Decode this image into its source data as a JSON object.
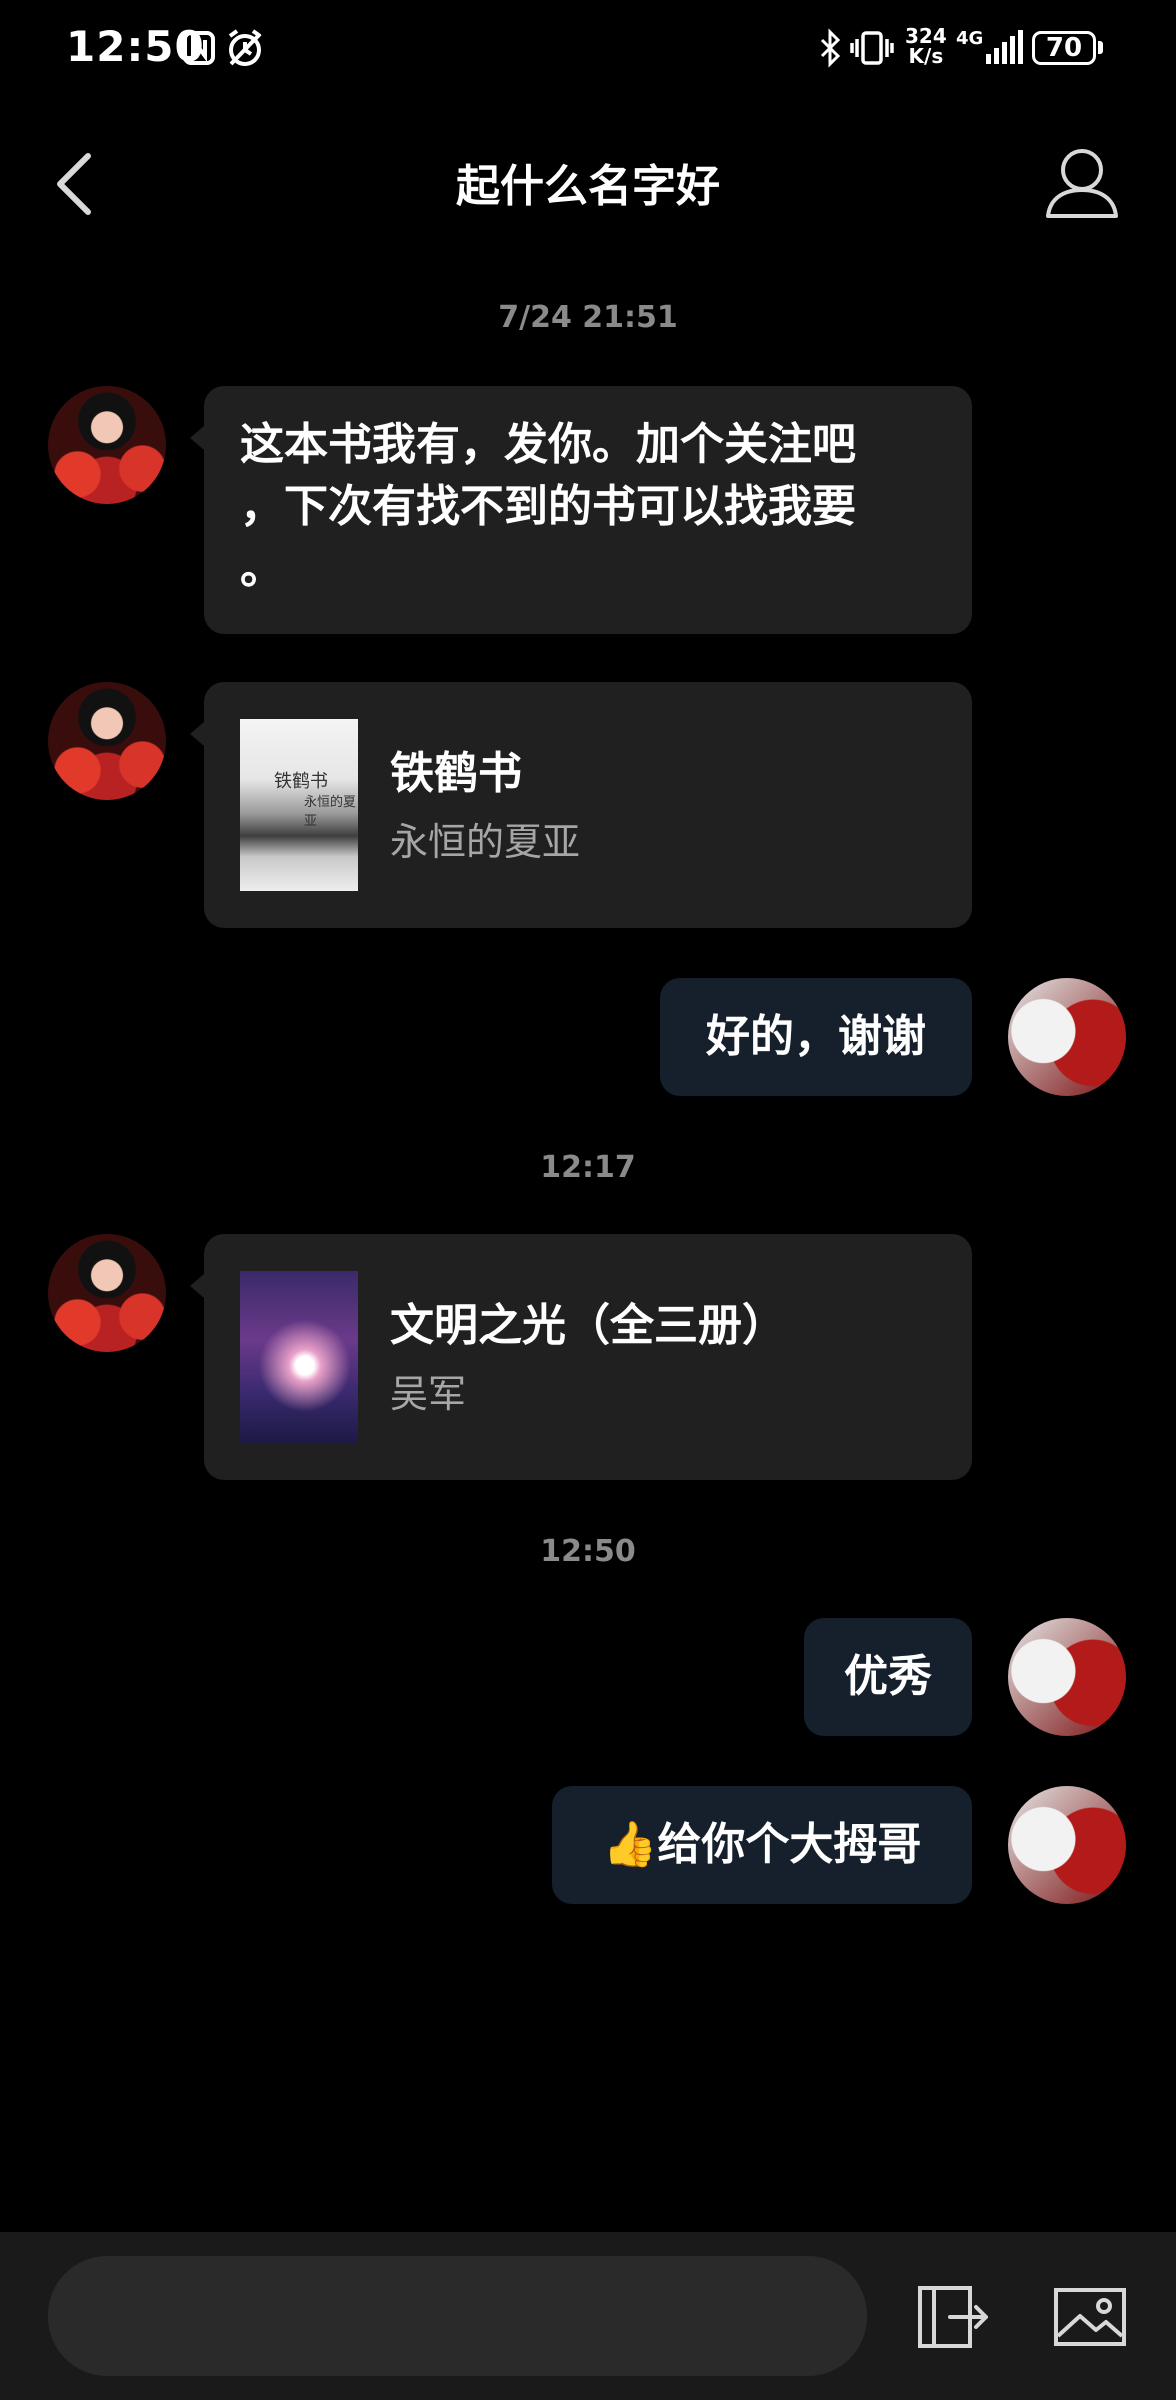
{
  "status_bar": {
    "time": "12:50",
    "speed_value": "324",
    "speed_unit": "K/s",
    "network": "4G",
    "battery": "70"
  },
  "header": {
    "title": "起什么名字好"
  },
  "messages": [
    {
      "type": "timestamp",
      "text": "7/24 21:51"
    },
    {
      "type": "text",
      "from": "other",
      "text_line1": "这本书我有，发你。加个关注吧",
      "text_line2": "，下次有找不到的书可以找我要",
      "text_line3": "。"
    },
    {
      "type": "book",
      "from": "other",
      "title": "铁鹤书",
      "author": "永恒的夏亚",
      "cover_text_title": "铁鹤书",
      "cover_text_author": "永恒的夏亚"
    },
    {
      "type": "text",
      "from": "me",
      "text": "好的，谢谢"
    },
    {
      "type": "timestamp",
      "text": "12:17"
    },
    {
      "type": "book",
      "from": "other",
      "title": "文明之光（全三册）",
      "author": "吴军"
    },
    {
      "type": "timestamp",
      "text": "12:50"
    },
    {
      "type": "text",
      "from": "me",
      "text": "优秀"
    },
    {
      "type": "text",
      "from": "me",
      "emoji": "👍",
      "text": "给你个大拇哥"
    }
  ],
  "icons": {
    "back": "chevron-left-icon",
    "profile": "user-icon",
    "share": "share-out-icon",
    "image": "image-icon"
  },
  "colors": {
    "background": "#000000",
    "bubble_other": "#202020",
    "bubble_me": "#16202c",
    "timestamp": "#8a8a8a",
    "author": "#a6a6a6"
  }
}
